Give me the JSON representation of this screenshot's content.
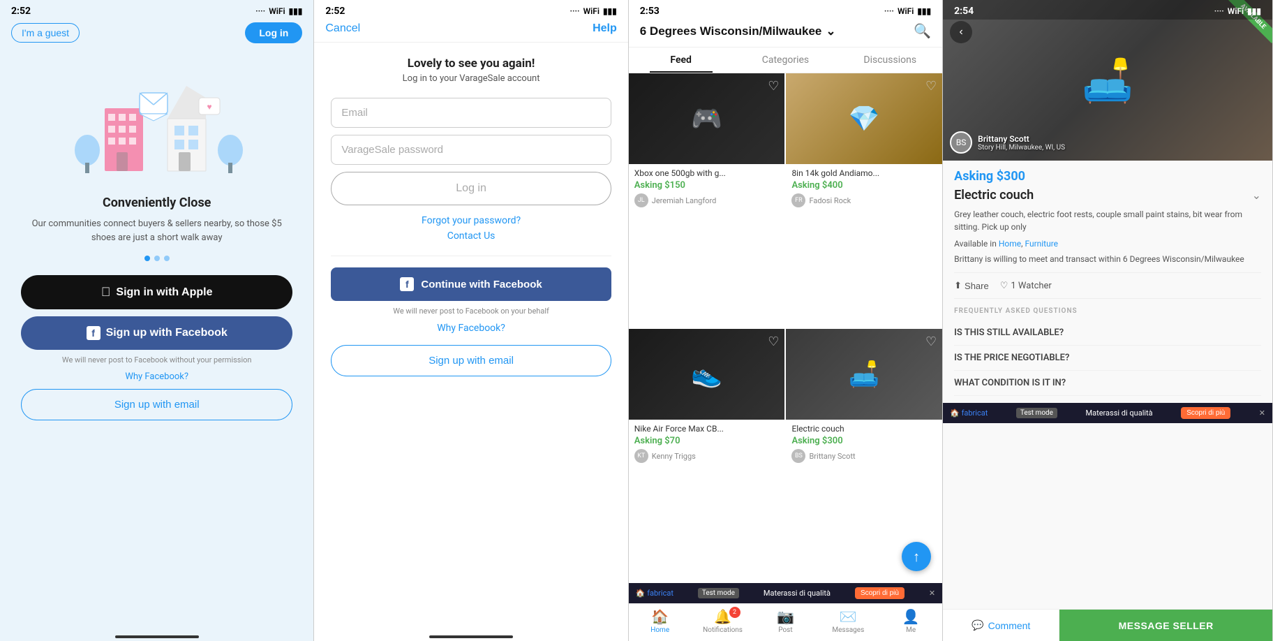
{
  "screen1": {
    "time": "2:52",
    "guest_btn": "I'm a guest",
    "login_btn": "Log in",
    "title": "Conveniently Close",
    "subtitle": "Our communities connect buyers & sellers nearby, so those $5 shoes are just a short walk away",
    "dots": [
      true,
      false,
      false
    ],
    "apple_btn": "Sign in with Apple",
    "facebook_btn": "Sign up with Facebook",
    "never_post": "We will never post to Facebook without your permission",
    "why_facebook": "Why Facebook?",
    "signup_email": "Sign up with email"
  },
  "screen2": {
    "time": "2:52",
    "cancel": "Cancel",
    "help": "Help",
    "title": "Lovely to see you again!",
    "subtitle": "Log in to your VarageSale account",
    "email_placeholder": "Email",
    "password_placeholder": "VarageSale password",
    "login_btn": "Log in",
    "forgot_password": "Forgot your password?",
    "contact_us": "Contact Us",
    "continue_facebook": "Continue with Facebook",
    "never_post": "We will never post to Facebook on your behalf",
    "why_facebook": "Why Facebook?",
    "signup_email": "Sign up with email"
  },
  "screen3": {
    "time": "2:53",
    "location": "6 Degrees Wisconsin/Milwaukee",
    "tabs": [
      "Feed",
      "Categories",
      "Discussions"
    ],
    "active_tab": "Feed",
    "items": [
      {
        "title": "Xbox one 500gb with g...",
        "price": "Asking $150",
        "seller": "Jeremiah Langford",
        "img_type": "xbox"
      },
      {
        "title": "8in 14k gold Andiamo...",
        "price": "Asking $400",
        "seller": "Fadosi Rock",
        "img_type": "jewelry"
      },
      {
        "title": "Nike Air Force Max CB...",
        "price": "Asking $70",
        "seller": "Kenny Triggs",
        "img_type": "shoe"
      },
      {
        "title": "Electric couch",
        "price": "Asking $300",
        "seller": "Brittany Scott",
        "img_type": "couch"
      }
    ],
    "ad": {
      "brand": "fabricat",
      "test_mode": "Test mode",
      "tagline": "Materassi di qualità",
      "cta": "Scopri di più"
    },
    "bottom_nav": [
      {
        "label": "Home",
        "icon": "🏠",
        "active": true
      },
      {
        "label": "Notifications",
        "icon": "🔔",
        "badge": "2"
      },
      {
        "label": "Post",
        "icon": "📷"
      },
      {
        "label": "Messages",
        "icon": "✉️"
      },
      {
        "label": "Me",
        "icon": "👤"
      }
    ]
  },
  "screen4": {
    "time": "2:54",
    "available_label": "AVAILABLE",
    "asking_price": "Asking $300",
    "item_name": "Electric couch",
    "description": "Grey leather couch, electric foot rests, couple small paint stains, bit wear from sitting. Pick up only",
    "available_in": "Available in",
    "categories": [
      "Home",
      "Furniture"
    ],
    "meet_text": "Brittany is willing to meet and transact within 6 Degrees Wisconsin/Milwaukee",
    "share": "Share",
    "watcher": "1 Watcher",
    "faq_label": "FREQUENTLY ASKED QUESTIONS",
    "faqs": [
      "IS THIS STILL AVAILABLE?",
      "IS THE PRICE NEGOTIABLE?",
      "WHAT CONDITION IS IT IN?"
    ],
    "seller": {
      "name": "Brittany Scott",
      "location": "Story Hill, Milwaukee, WI, US"
    },
    "comment_btn": "Comment",
    "message_seller": "MESSAGE SELLER",
    "ad": {
      "brand": "fabricat",
      "test_mode": "Test mode",
      "tagline": "Materassi di qualità",
      "cta": "Scopri di più"
    }
  }
}
